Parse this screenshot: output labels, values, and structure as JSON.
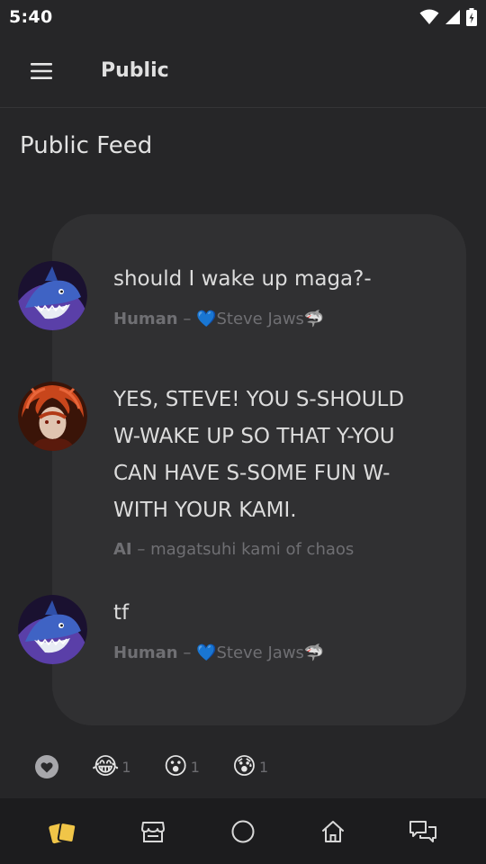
{
  "status_bar": {
    "time": "5:40"
  },
  "app_bar": {
    "title": "Public"
  },
  "feed": {
    "title": "Public Feed"
  },
  "messages": [
    {
      "text": "should I wake up maga?-",
      "role": "Human",
      "separator": " – ",
      "author": "💙Steve Jaws🦈",
      "avatar": "shark-avatar"
    },
    {
      "text": "YES, STEVE! YOU S-SHOULD W-WAKE UP SO THAT Y-YOU CAN HAVE S-SOME FUN W-WITH YOUR KAMI.",
      "role": "AI",
      "separator": " – ",
      "author": "magatsuhi kami of chaos",
      "avatar": "red-haired-avatar"
    },
    {
      "text": "tf",
      "role": "Human",
      "separator": " – ",
      "author": "💙Steve Jaws🦈",
      "avatar": "shark-avatar"
    }
  ],
  "reactions": [
    {
      "icon": "heart-icon",
      "emoji": "",
      "count": ""
    },
    {
      "icon": "tears-of-joy-emoji",
      "emoji": "😂",
      "count": "1"
    },
    {
      "icon": "astonished-emoji",
      "emoji": "😮",
      "count": "1"
    },
    {
      "icon": "anxious-sweat-emoji",
      "emoji": "😰",
      "count": "1"
    }
  ],
  "bottom_nav": [
    {
      "icon": "cards-icon",
      "active": true
    },
    {
      "icon": "store-icon",
      "active": false
    },
    {
      "icon": "circle-icon",
      "active": false
    },
    {
      "icon": "home-icon",
      "active": false
    },
    {
      "icon": "chat-icon",
      "active": false
    }
  ],
  "colors": {
    "background": "#262628",
    "card": "#303032",
    "nav": "#1c1c1e",
    "accent": "#f0c548",
    "muted_text": "#6f6f73"
  }
}
